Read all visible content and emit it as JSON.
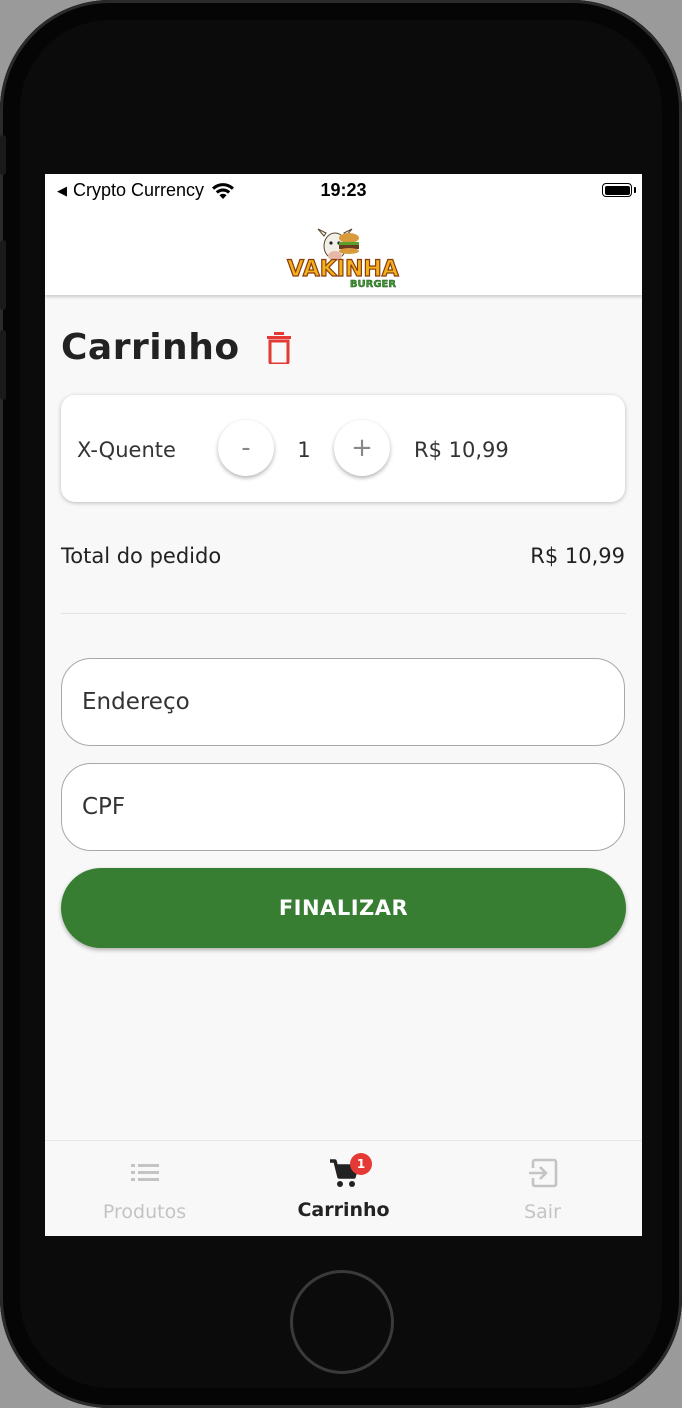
{
  "status_bar": {
    "carrier": "Crypto Currency",
    "time": "19:23",
    "back_arrow": "◀"
  },
  "app_bar": {
    "logo_text_main": "VAKINHA",
    "logo_text_sub": "BURGER"
  },
  "page": {
    "title": "Carrinho"
  },
  "cart": {
    "items": [
      {
        "name": "X-Quente",
        "quantity": "1",
        "price": "R$ 10,99",
        "minus_label": "-",
        "plus_label": "+"
      }
    ]
  },
  "total": {
    "label": "Total do pedido",
    "value": "R$ 10,99"
  },
  "form": {
    "address_placeholder": "Endereço",
    "cpf_placeholder": "CPF",
    "submit_label": "FINALIZAR"
  },
  "bottom_nav": {
    "items": [
      {
        "label": "Produtos",
        "icon": "list-icon",
        "active": false
      },
      {
        "label": "Carrinho",
        "icon": "cart-icon",
        "active": true,
        "badge": "1"
      },
      {
        "label": "Sair",
        "icon": "exit-icon",
        "active": false
      }
    ]
  },
  "colors": {
    "accent_green": "#377e33",
    "delete_red": "#e53935",
    "badge_red": "#e53935"
  }
}
